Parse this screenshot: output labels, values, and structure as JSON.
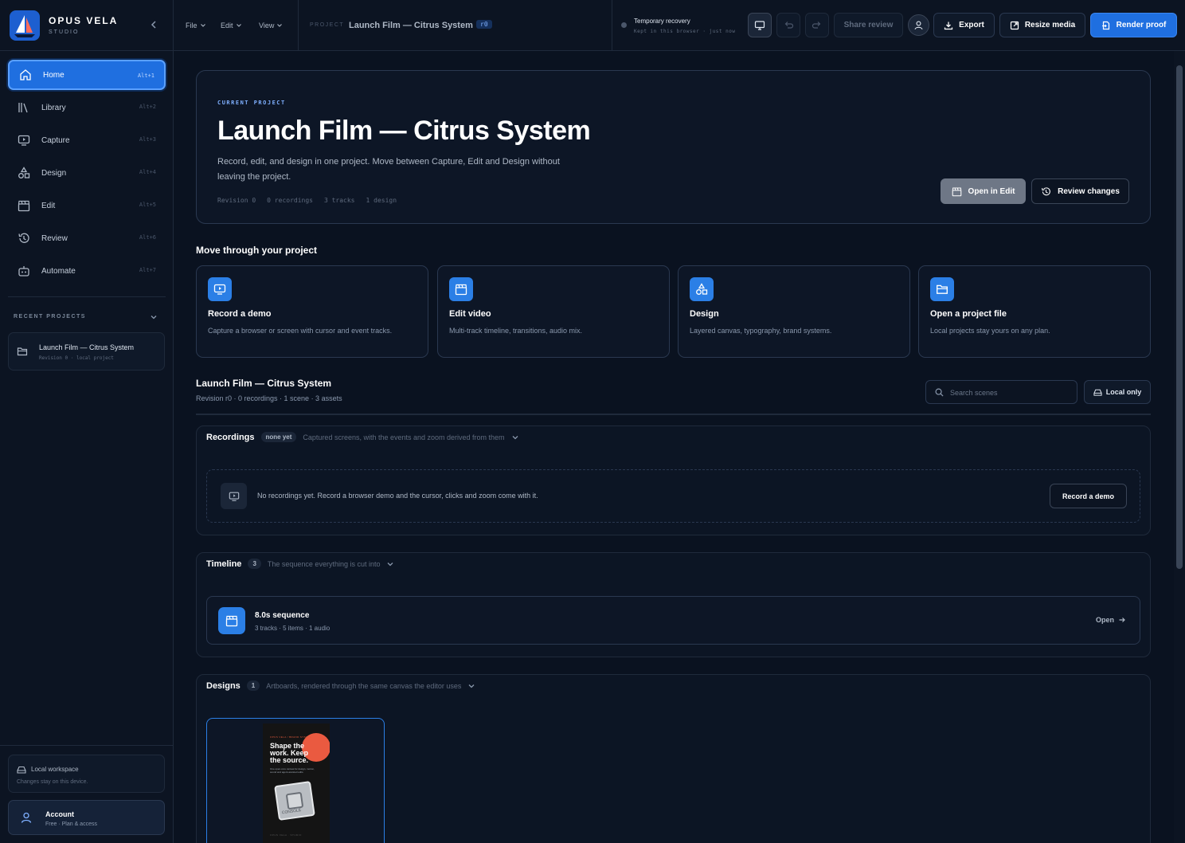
{
  "brand": {
    "name": "OPUS VELA",
    "sub": "STUDIO"
  },
  "nav": [
    {
      "label": "Home",
      "kbd": "Alt+1",
      "icon": "home-icon"
    },
    {
      "label": "Library",
      "kbd": "Alt+2",
      "icon": "library-icon"
    },
    {
      "label": "Capture",
      "kbd": "Alt+3",
      "icon": "capture-icon"
    },
    {
      "label": "Design",
      "kbd": "Alt+4",
      "icon": "design-icon"
    },
    {
      "label": "Edit",
      "kbd": "Alt+5",
      "icon": "clapper-icon"
    },
    {
      "label": "Review",
      "kbd": "Alt+6",
      "icon": "history-icon"
    },
    {
      "label": "Automate",
      "kbd": "Alt+7",
      "icon": "robot-icon"
    }
  ],
  "recent": {
    "heading": "RECENT PROJECTS",
    "items": [
      {
        "name": "Launch Film — Citrus System",
        "meta": "Revision 0 · local project"
      }
    ]
  },
  "workspace": {
    "title": "Local workspace",
    "desc": "Changes stay on this device."
  },
  "account": {
    "title": "Account",
    "desc": "Free · Plan & access"
  },
  "topbar": {
    "menus": [
      "File",
      "Edit",
      "View"
    ],
    "project_label": "PROJECT",
    "project_title": "Launch Film — Citrus System",
    "project_badge": "r0",
    "recovery_title": "Temporary recovery",
    "recovery_desc": "Kept in this browser · just now",
    "share_review": "Share review",
    "export": "Export",
    "resize_media": "Resize media",
    "render_proof": "Render proof"
  },
  "hero": {
    "eyebrow": "CURRENT PROJECT",
    "title": "Launch Film — Citrus System",
    "desc": "Record, edit, and design in one project. Move between Capture, Edit and Design without leaving the project.",
    "meta": [
      "Revision 0",
      "0 recordings",
      "3 tracks",
      "1 design"
    ],
    "open_in_edit": "Open in Edit",
    "review_changes": "Review changes"
  },
  "flow": {
    "heading": "Move through your project",
    "cards": [
      {
        "title": "Record a demo",
        "desc": "Capture a browser or screen with cursor and event tracks.",
        "icon": "capture-icon"
      },
      {
        "title": "Edit video",
        "desc": "Multi-track timeline, transitions, audio mix.",
        "icon": "clapper-icon"
      },
      {
        "title": "Design",
        "desc": "Layered canvas, typography, brand systems.",
        "icon": "design-icon"
      },
      {
        "title": "Open a project file",
        "desc": "Local projects stay yours on any plan.",
        "icon": "folder-icon"
      }
    ]
  },
  "project": {
    "title": "Launch Film — Citrus System",
    "sub": "Revision r0 · 0 recordings · 1 scene · 3 assets",
    "search_placeholder": "Search scenes",
    "local_only": "Local only"
  },
  "recordings": {
    "title": "Recordings",
    "badge": "none yet",
    "desc": "Captured screens, with the events and zoom derived from them",
    "empty": "No recordings yet. Record a browser demo and the cursor, clicks and zoom come with it.",
    "cta": "Record a demo"
  },
  "timeline": {
    "title": "Timeline",
    "badge": "3",
    "desc": "The sequence everything is cut into",
    "seq_title": "8.0s sequence",
    "seq_meta": "3 tracks · 5 items · 1 audio",
    "open": "Open"
  },
  "designs": {
    "title": "Designs",
    "badge": "1",
    "desc": "Artboards, rendered through the same canvas the editor uses",
    "artboard": {
      "eyebrow": "OPUS VELA / BRAND SYSTEM",
      "headline": "Shape the work. Keep the source.",
      "sub": "One open-core canvas for design, motion, sound and agent-assisted edits.",
      "chip": "CONSOLE",
      "footer": "OPUS VELA · STUDIO"
    }
  },
  "colors": {
    "accent": "#1f6fe0",
    "background": "#0a1220",
    "panel": "#0d1626",
    "art_circle": "#ea5a40"
  }
}
